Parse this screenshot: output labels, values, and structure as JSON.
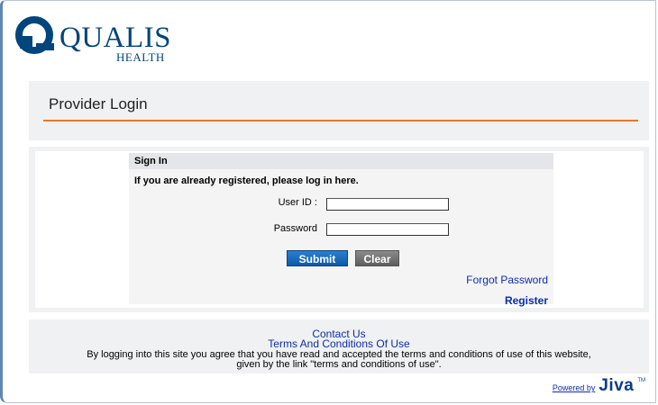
{
  "logo": {
    "brand": "QUALIS",
    "sub": "HEALTH",
    "icon": "qualis-q-logo"
  },
  "page_title": "Provider Login",
  "signin": {
    "header": "Sign In",
    "message": "If you are already registered, please log in here.",
    "user_label": "User ID :",
    "password_label": "Password",
    "user_value": "",
    "password_value": "",
    "submit_label": "Submit",
    "clear_label": "Clear",
    "forgot_link": "Forgot Password",
    "register_link": "Register"
  },
  "footer": {
    "contact": "Contact Us",
    "terms": "Terms And Conditions Of Use",
    "legal_line1": "By logging into this site you agree that you have read and accepted the terms and conditions of use of this website,",
    "legal_line2": "given by the link \"terms and conditions of use\"."
  },
  "powered": {
    "label": "Powered by",
    "brand": "Jiva",
    "tm": "TM"
  },
  "colors": {
    "brand_blue": "#00457c",
    "accent_orange": "#e07a2a",
    "link_blue": "#0b2ea8",
    "submit_blue": "#1567bb",
    "clear_gray": "#6e6e6e"
  }
}
